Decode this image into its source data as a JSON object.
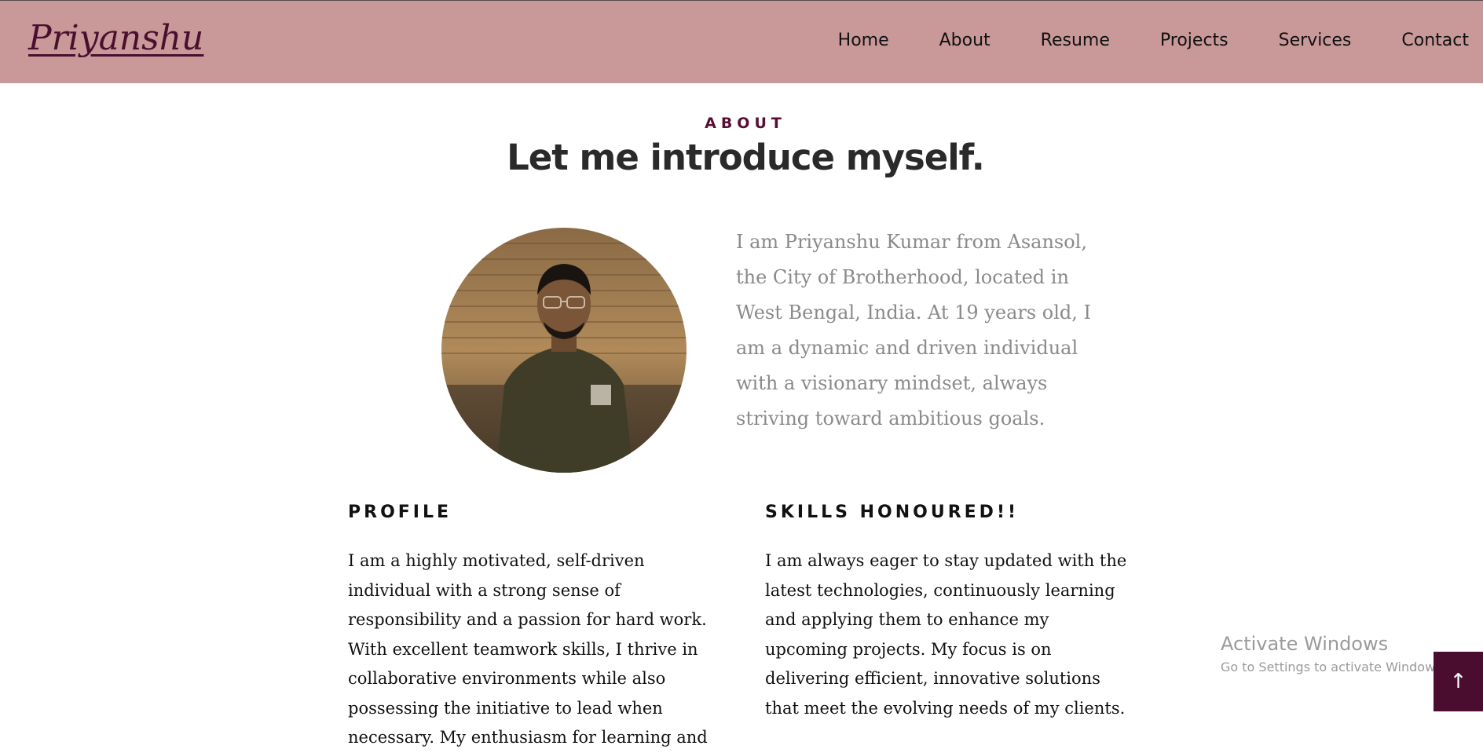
{
  "brand": {
    "logo_text": "Priyanshu"
  },
  "nav": {
    "items": [
      "Home",
      "About",
      "Resume",
      "Projects",
      "Services",
      "Contact"
    ]
  },
  "about": {
    "eyebrow": "ABOUT",
    "headline": "Let me introduce myself.",
    "intro": "I am Priyanshu Kumar from Asansol, the City of Brotherhood, located in West Bengal, India. At 19 years old, I am a dynamic and driven individual with a visionary mindset, always striving toward ambitious goals."
  },
  "profile": {
    "title": "PROFILE",
    "text": "I am a highly motivated, self-driven individual with a strong sense of responsibility and a passion for hard work. With excellent teamwork skills, I thrive in collaborative environments while also possessing the initiative to lead when necessary. My enthusiasm for learning and"
  },
  "skills": {
    "title": "SKILLS HONOURED!!",
    "text": "I am always eager to stay updated with the latest technologies, continuously learning and applying them to enhance my upcoming projects. My focus is on delivering efficient, innovative solutions that meet the evolving needs of my clients."
  },
  "windows_watermark": {
    "line1": "Activate Windows",
    "line2": "Go to Settings to activate Windows."
  },
  "scroll_top": {
    "icon": "arrow-up-icon",
    "glyph": "↑"
  },
  "colors": {
    "navbar_bg": "#c99898",
    "accent": "#4a0d30",
    "intro_text": "#8a8a8a"
  }
}
